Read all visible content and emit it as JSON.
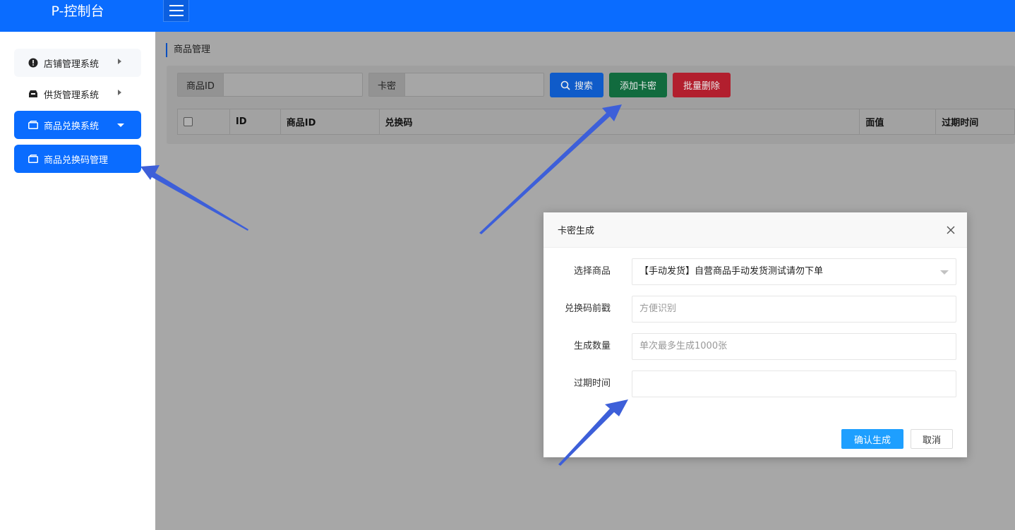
{
  "app": {
    "title": "P-控制台"
  },
  "sidebar": {
    "items": [
      {
        "label": "店铺管理系统",
        "icon": "alert-circle-icon"
      },
      {
        "label": "供货管理系统",
        "icon": "inbox-icon"
      },
      {
        "label": "商品兑换系统",
        "icon": "folder-icon"
      },
      {
        "label": "商品兑换码管理",
        "icon": "folder-icon"
      }
    ]
  },
  "main": {
    "breadcrumb": "商品管理",
    "filters": {
      "product_id_label": "商品ID",
      "card_secret_label": "卡密"
    },
    "buttons": {
      "search": "搜索",
      "add_card": "添加卡密",
      "batch_delete": "批量删除"
    },
    "table": {
      "columns": [
        "ID",
        "商品ID",
        "兑换码",
        "面值",
        "过期时间"
      ]
    }
  },
  "modal": {
    "title": "卡密生成",
    "fields": {
      "product": {
        "label": "选择商品",
        "value": "【手动发货】自营商品手动发货测试请勿下单"
      },
      "prefix": {
        "label": "兑换码前戳",
        "placeholder": "方便识别"
      },
      "quantity": {
        "label": "生成数量",
        "placeholder": "单次最多生成1000张"
      },
      "expiry": {
        "label": "过期时间",
        "value": ""
      }
    },
    "buttons": {
      "confirm": "确认生成",
      "cancel": "取消"
    }
  },
  "colors": {
    "primary": "#0a6cff",
    "modal_confirm": "#1e9fff",
    "annotation_arrow": "#3d5fd9"
  }
}
